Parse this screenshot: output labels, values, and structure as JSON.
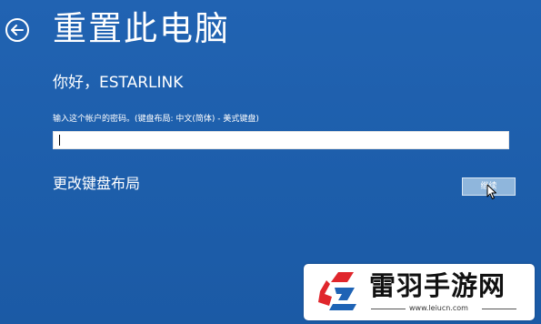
{
  "page": {
    "title": "重置此电脑",
    "greeting": "你好，ESTARLINK",
    "password_prompt": "输入这个帐户的密码。(键盘布局: 中文(简体) - 美式键盘)",
    "password_value": "",
    "change_keyboard_link": "更改键盘布局",
    "next_button": "继续"
  },
  "icons": {
    "back": "back-arrow-icon",
    "cursor": "mouse-pointer-icon",
    "watermark_logo": "leiyu-logo-icon"
  },
  "watermark": {
    "name": "雷羽手游网",
    "url": "www.leiucn.com"
  },
  "colors": {
    "background": "#1f5fae",
    "button_fill": "#8fb6dc",
    "watermark_red": "#e0262c",
    "watermark_blue": "#1e63b5"
  }
}
